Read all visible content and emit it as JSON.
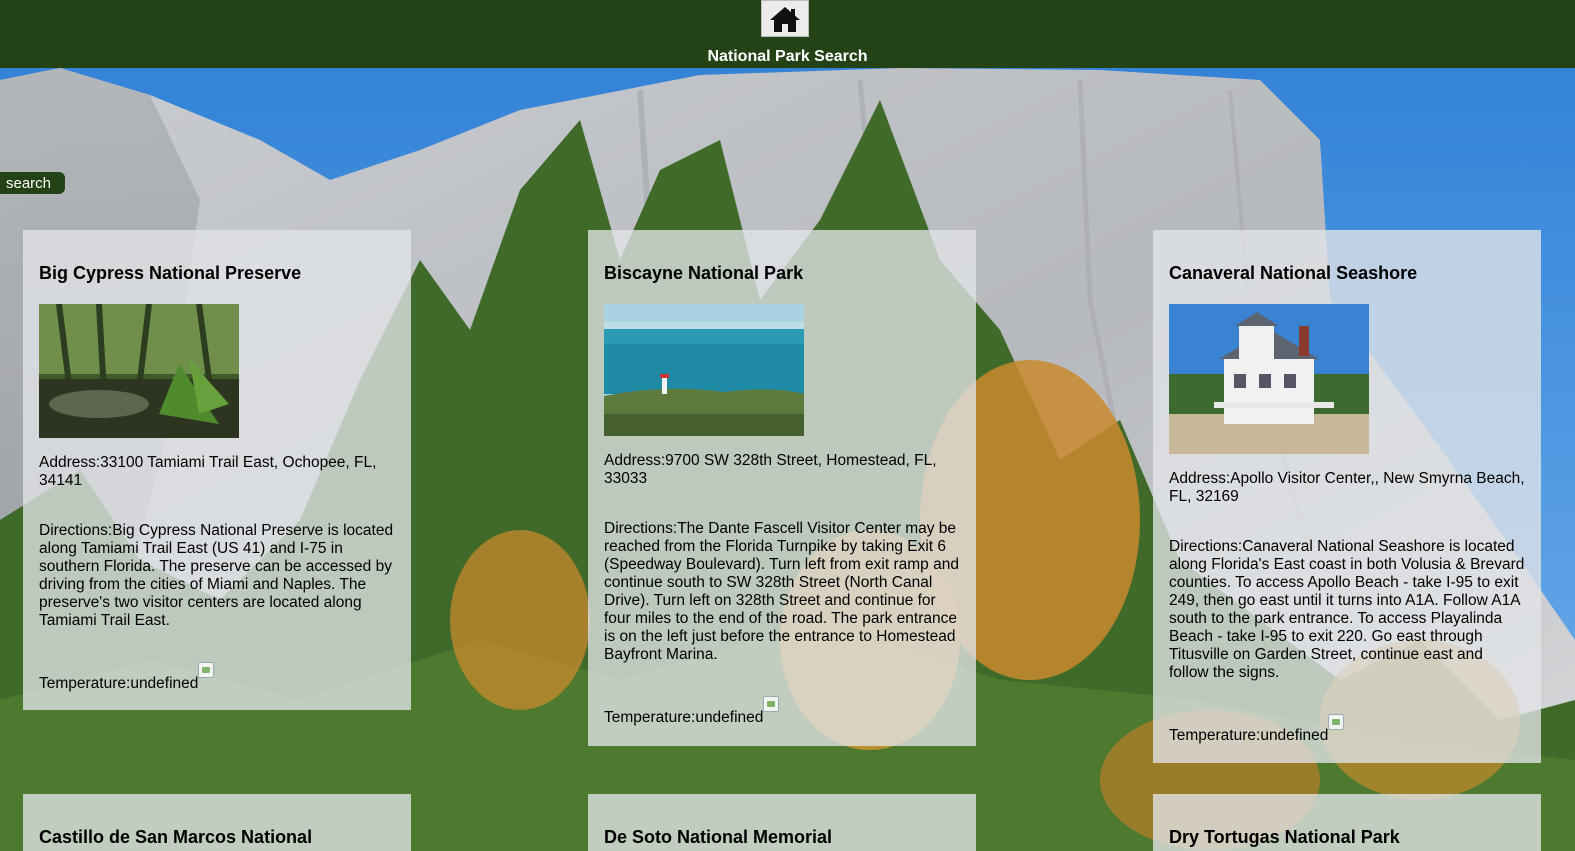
{
  "header": {
    "title": "National Park Search",
    "home_icon": "home-icon",
    "bar_color": "#234216"
  },
  "search": {
    "label": "search"
  },
  "parks": [
    {
      "name": "Big Cypress National Preserve",
      "address": "Address:33100 Tamiami Trail East, Ochopee, FL, 34141",
      "directions": "Directions:Big Cypress National Preserve is located along Tamiami Trail East (US 41) and I-75 in southern Florida. The preserve can be accessed by driving from the cities of Miami and Naples. The preserve's two visitor centers are located along Tamiami Trail East.",
      "temperature": "Temperature:undefined"
    },
    {
      "name": "Biscayne National Park",
      "address": "Address:9700 SW 328th Street, Homestead, FL, 33033",
      "directions": "Directions:The Dante Fascell Visitor Center may be reached from the Florida Turnpike by taking Exit 6 (Speedway Boulevard). Turn left from exit ramp and continue south to SW 328th Street (North Canal Drive). Turn left on 328th Street and continue for four miles to the end of the road. The park entrance is on the left just before the entrance to Homestead Bayfront Marina.",
      "temperature": "Temperature:undefined"
    },
    {
      "name": "Canaveral National Seashore",
      "address": "Address:Apollo Visitor Center,, New Smyrna Beach, FL, 32169",
      "directions": "Directions:Canaveral National Seashore is located along Florida's East coast in both Volusia & Brevard counties. To access Apollo Beach - take I-95 to exit 249, then go east until it turns into A1A. Follow A1A south to the park entrance. To access Playalinda Beach - take I-95 to exit 220. Go east through Titusville on Garden Street, continue east and follow the signs.",
      "temperature": "Temperature:undefined"
    },
    {
      "name": "Castillo de San Marcos National"
    },
    {
      "name": "De Soto National Memorial"
    },
    {
      "name": "Dry Tortugas National Park"
    }
  ]
}
